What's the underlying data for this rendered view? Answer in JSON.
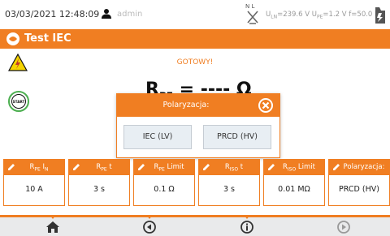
{
  "header": {
    "datetime": "03/03/2021 12:48:09",
    "user": "admin",
    "plug_labels": "N L",
    "uln_value": "=239.6 V",
    "upe_value": "=1.2 V",
    "freq": "f=50.0 Hz"
  },
  "title": "Test IEC",
  "status": "GOTOWY!",
  "result": {
    "value": "= ---- Ω"
  },
  "dialog": {
    "title": "Polaryzacja:",
    "options": [
      "IEC (LV)",
      "PRCD (HV)"
    ]
  },
  "params": [
    {
      "value": "10 A"
    },
    {
      "value": "3 s"
    },
    {
      "label": "Limit",
      "value": "0.1 Ω"
    },
    {
      "value": "3 s"
    },
    {
      "label": "Limit",
      "value": "0.01 MΩ"
    },
    {
      "label": "Polaryzacja:",
      "value": "PRCD (HV)"
    }
  ],
  "colors": {
    "accent": "#f07e22",
    "bottom_bar": "#e9eaeb",
    "option_bg": "#e8eef3"
  },
  "icons": [
    "user-icon",
    "plug-icon",
    "battery-icon",
    "logo-icon",
    "warning-icon",
    "start-icon",
    "close-icon",
    "pencil-icon",
    "home-icon",
    "back-icon",
    "info-icon",
    "forward-icon"
  ]
}
